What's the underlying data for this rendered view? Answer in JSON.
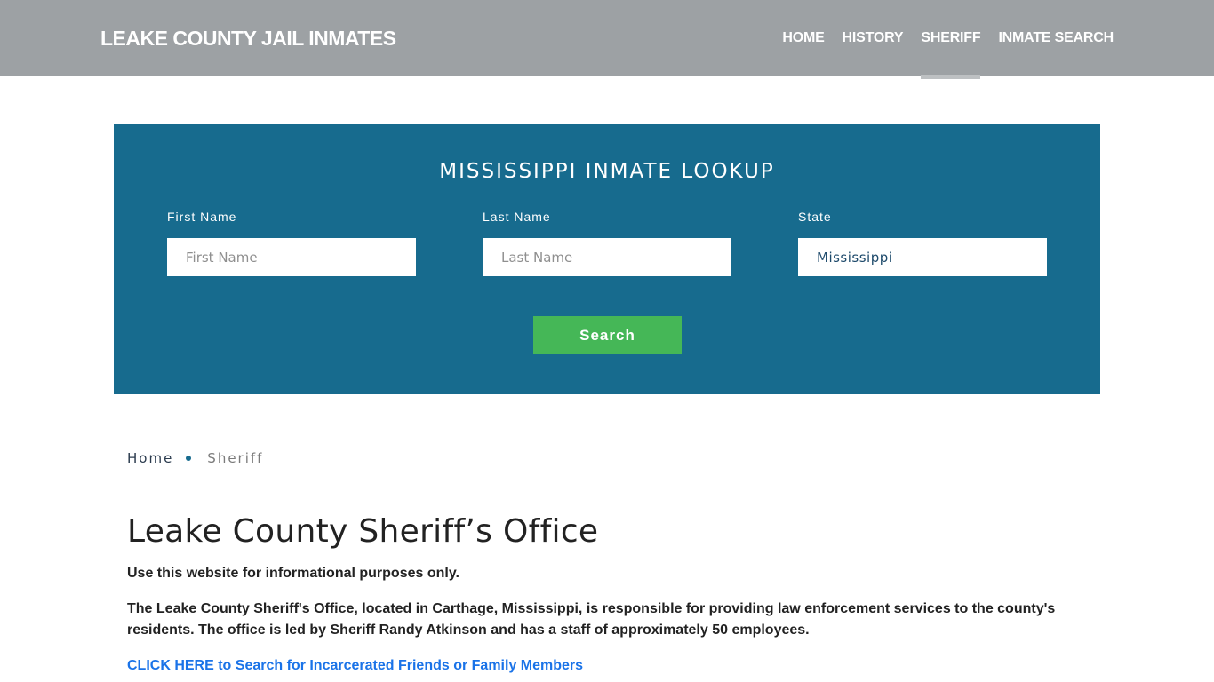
{
  "header": {
    "brand": "LEAKE COUNTY JAIL INMATES",
    "nav": [
      {
        "label": "HOME",
        "active": false
      },
      {
        "label": "HISTORY",
        "active": false
      },
      {
        "label": "SHERIFF",
        "active": true
      },
      {
        "label": "INMATE SEARCH",
        "active": false
      }
    ]
  },
  "lookup": {
    "title": "MISSISSIPPI INMATE LOOKUP",
    "first_name": {
      "label": "First Name",
      "placeholder": "First Name",
      "value": ""
    },
    "last_name": {
      "label": "Last Name",
      "placeholder": "Last Name",
      "value": ""
    },
    "state": {
      "label": "State",
      "value": "Mississippi"
    },
    "search_label": "Search"
  },
  "breadcrumb": {
    "home": "Home",
    "current": "Sheriff"
  },
  "content": {
    "title": "Leake County Sheriff’s Office",
    "disclaimer": "Use this website for informational purposes only.",
    "description": "The Leake County Sheriff's Office, located in Carthage, Mississippi, is responsible for providing law enforcement services to the county's residents. The office is led by Sheriff Randy Atkinson and has a staff of approximately 50 employees.",
    "cta": "CLICK HERE to Search for Incarcerated Friends or Family Members"
  },
  "colors": {
    "header_bg": "#9da1a4",
    "lookup_bg": "#176b8e",
    "search_button": "#45b757",
    "link": "#1a73e8"
  }
}
